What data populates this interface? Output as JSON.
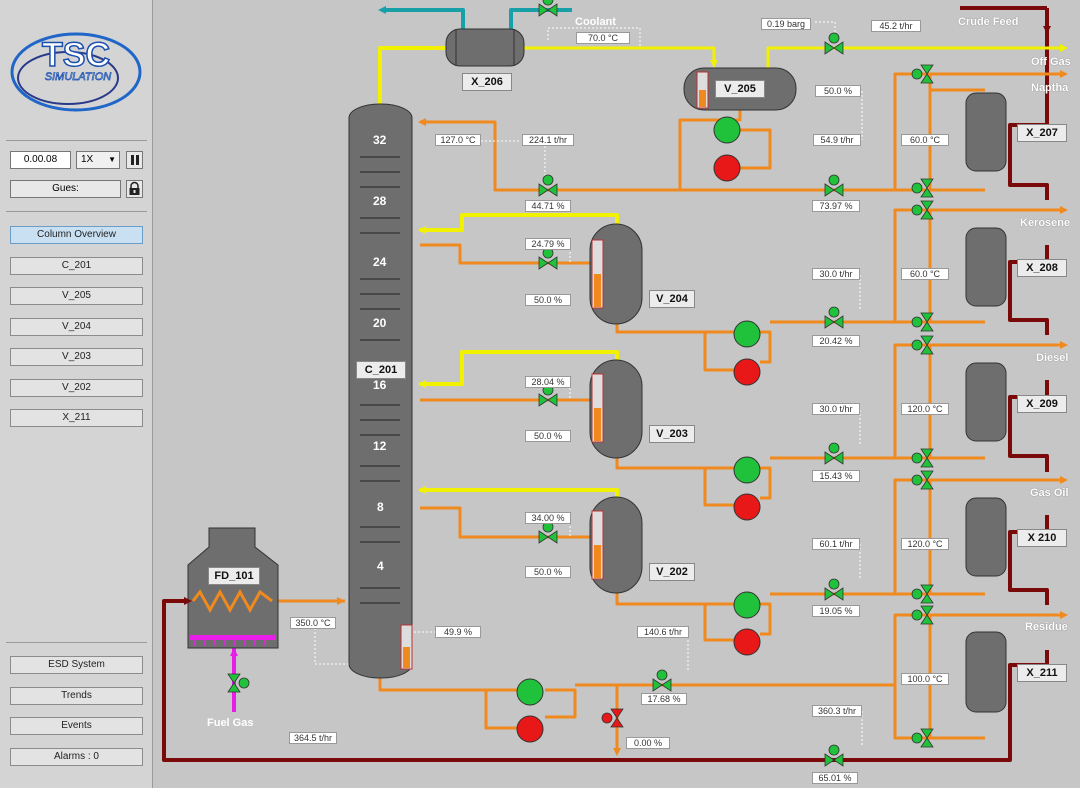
{
  "app": {
    "logo_text": "TSC",
    "logo_subtitle": "SIMULATION"
  },
  "sidebar": {
    "time": "0.00.08",
    "speed": "1X",
    "user": "Gues:",
    "nav": [
      {
        "label": "Column Overview",
        "active": true
      },
      {
        "label": "C_201"
      },
      {
        "label": "V_205"
      },
      {
        "label": "V_204"
      },
      {
        "label": "V_203"
      },
      {
        "label": "V_202"
      },
      {
        "label": "X_211"
      }
    ],
    "bottom": [
      {
        "label": "ESD System"
      },
      {
        "label": "Trends"
      },
      {
        "label": "Events"
      },
      {
        "label": "Alarms : 0"
      }
    ]
  },
  "equipment": {
    "column": "C_201",
    "furnace": "FD_101",
    "cooler": "X_206",
    "reflux_drum": "V_205",
    "strippers": [
      "V_204",
      "V_203",
      "V_202"
    ],
    "exchangers": [
      "X_207",
      "X_208",
      "X_209",
      "X 210",
      "X_211"
    ]
  },
  "trays": [
    "32",
    "28",
    "24",
    "20",
    "16",
    "12",
    "8",
    "4"
  ],
  "streams": {
    "crude_feed": "Crude Feed",
    "off_gas": "Off Gas",
    "naptha": "Naptha",
    "kerosene": "Kerosene",
    "diesel": "Diesel",
    "gas_oil": "Gas Oil",
    "residue": "Residue",
    "coolant": "Coolant",
    "fuel_gas": "Fuel Gas"
  },
  "values": {
    "coolant_temp": "70.0 °C",
    "offgas_pressure": "0.19 barg",
    "offgas_flow": "45.2 t/hr",
    "v205_level": "50.0 %",
    "top_temp": "127.0 °C",
    "reflux_flow": "224.1 t/hr",
    "reflux_valve": "44.71 %",
    "naptha_flow": "54.9 t/hr",
    "naptha_valve": "73.97 %",
    "x207_temp": "60.0 °C",
    "v204_draw": "24.79 %",
    "v204_level": "50.0 %",
    "kero_flow": "30.0 t/hr",
    "kero_valve": "20.42 %",
    "x208_temp": "60.0 °C",
    "v203_draw": "28.04 %",
    "v203_level": "50.0 %",
    "diesel_flow": "30.0 t/hr",
    "diesel_valve": "15.43 %",
    "x209_temp": "120.0 °C",
    "v202_draw": "34.00 %",
    "v202_level": "50.0 %",
    "gasoil_flow": "60.1 t/hr",
    "gasoil_valve": "19.05 %",
    "x210_temp": "120.0 °C",
    "furnace_temp": "350.0 °C",
    "bottom_level": "49.9 %",
    "bottom_flow": "140.6 t/hr",
    "bottom_valve": "17.68 %",
    "bypass_valve": "0.00 %",
    "x211_temp": "100.0 °C",
    "feed_flow": "364.5 t/hr",
    "crude_flow": "360.3 t/hr",
    "crude_valve": "65.01 %"
  },
  "colors": {
    "vapor": "#f2f200",
    "liquid": "#f08a1e",
    "crude": "#7a0a0a",
    "coolant": "#17a0a8",
    "fuel_gas": "#e81ee8",
    "pump_running": "#1fc23a",
    "pump_stopped": "#e81818"
  }
}
